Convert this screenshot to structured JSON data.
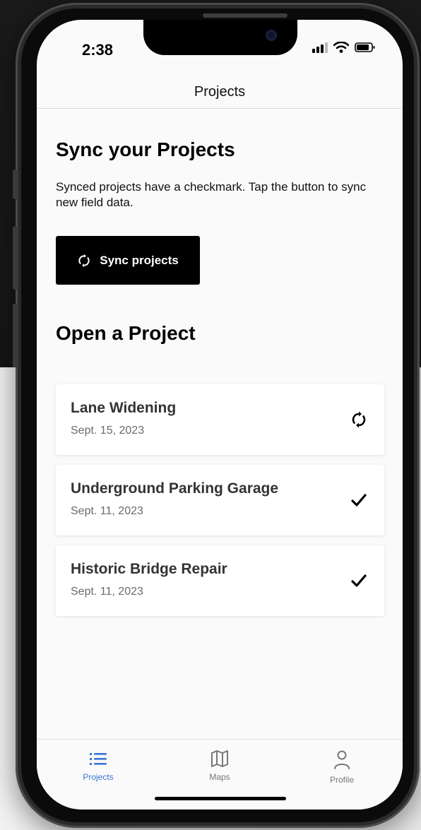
{
  "status": {
    "time": "2:38"
  },
  "nav": {
    "title": "Projects"
  },
  "sync_section": {
    "title": "Sync your Projects",
    "description": "Synced projects have a checkmark. Tap the button to sync new field data.",
    "button_label": "Sync projects"
  },
  "open_section": {
    "title": "Open a Project"
  },
  "projects": [
    {
      "name": "Lane Widening",
      "date": "Sept. 15, 2023",
      "status_icon": "sync-icon"
    },
    {
      "name": "Underground Parking Garage",
      "date": "Sept. 11, 2023",
      "status_icon": "checkmark-icon"
    },
    {
      "name": "Historic Bridge Repair",
      "date": "Sept. 11, 2023",
      "status_icon": "checkmark-icon"
    }
  ],
  "tabbar": {
    "items": [
      {
        "label": "Projects",
        "icon": "list-icon",
        "active": true
      },
      {
        "label": "Maps",
        "icon": "map-icon",
        "active": false
      },
      {
        "label": "Profile",
        "icon": "user-icon",
        "active": false
      }
    ]
  },
  "colors": {
    "accent": "#3b74d8",
    "button": "#000000",
    "screen_bg": "#fafafa"
  }
}
